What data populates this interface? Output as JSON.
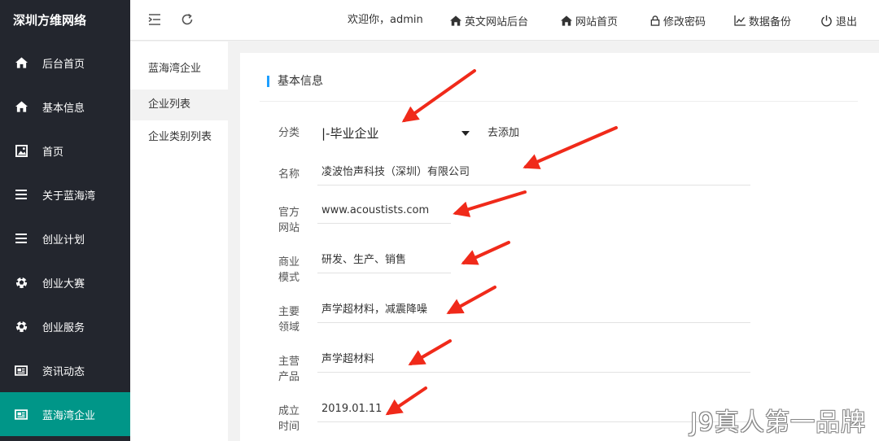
{
  "brand": "深圳方维网络",
  "sidebar": {
    "items": [
      {
        "label": "后台首页",
        "icon": "home-icon"
      },
      {
        "label": "基本信息",
        "icon": "home-icon"
      },
      {
        "label": "首页",
        "icon": "image-icon"
      },
      {
        "label": "关于蓝海湾",
        "icon": "menu-icon"
      },
      {
        "label": "创业计划",
        "icon": "menu-icon"
      },
      {
        "label": "创业大赛",
        "icon": "football-icon"
      },
      {
        "label": "创业服务",
        "icon": "football-icon"
      },
      {
        "label": "资讯动态",
        "icon": "newspaper-icon"
      },
      {
        "label": "蓝海湾企业",
        "icon": "newspaper-icon",
        "active": true
      }
    ],
    "active_color": "#009688"
  },
  "header": {
    "welcome": "欢迎你，admin",
    "links": [
      {
        "label": "英文网站后台",
        "icon": "home-icon"
      },
      {
        "label": "网站首页",
        "icon": "home-icon"
      },
      {
        "label": "修改密码",
        "icon": "lock-icon"
      },
      {
        "label": "数据备份",
        "icon": "chart-icon"
      },
      {
        "label": "退出",
        "icon": "power-icon"
      }
    ]
  },
  "submenu": {
    "title": "蓝海湾企业",
    "items": [
      {
        "label": "企业列表",
        "active": true
      },
      {
        "label": "企业类别列表"
      }
    ]
  },
  "form": {
    "section_title": "基本信息",
    "category": {
      "label": "分类",
      "value": "|-毕业企业",
      "add_link": "去添加"
    },
    "name": {
      "label": "名称",
      "value": "凌波怡声科技（深圳）有限公司"
    },
    "website": {
      "label_1": "官方",
      "label_2": "网站",
      "value": "www.acoustists.com"
    },
    "business": {
      "label_1": "商业",
      "label_2": "模式",
      "value": "研发、生产、销售"
    },
    "field": {
      "label_1": "主要",
      "label_2": "领域",
      "value": "声学超材料，减震降噪"
    },
    "product": {
      "label_1": "主营",
      "label_2": "产品",
      "value": "声学超材料"
    },
    "founded": {
      "label_1": "成立",
      "label_2": "时间",
      "value": "2019.01.11"
    }
  },
  "watermark": "J9真人第一品牌",
  "annotation_color": "#f02a1a"
}
